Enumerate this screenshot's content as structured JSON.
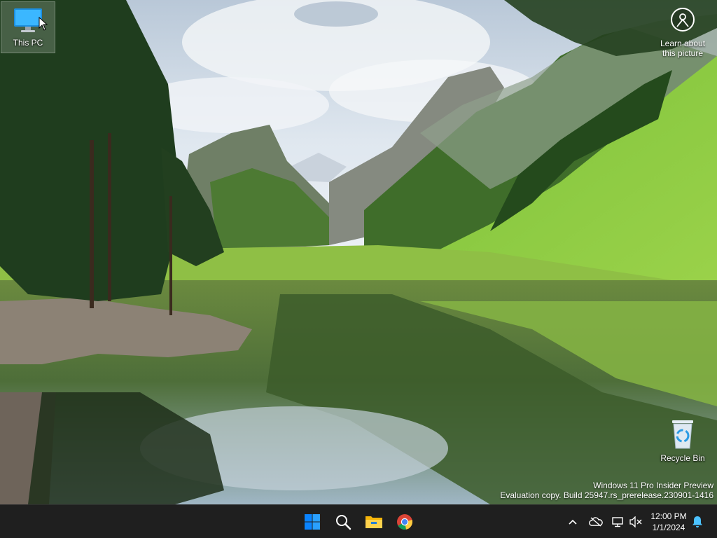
{
  "desktop": {
    "icons": [
      {
        "name": "this-pc",
        "label": "This PC"
      },
      {
        "name": "recycle-bin",
        "label": "Recycle Bin"
      }
    ],
    "spotlight": {
      "label_line1": "Learn about",
      "label_line2": "this picture",
      "icon": "camera-circle-icon"
    }
  },
  "watermark": {
    "line1": "Windows 11 Pro Insider Preview",
    "line2": "Evaluation copy. Build 25947.rs_prerelease.230901-1416"
  },
  "taskbar": {
    "apps": [
      {
        "name": "start",
        "icon": "windows-logo-icon"
      },
      {
        "name": "search",
        "icon": "search-icon"
      },
      {
        "name": "file-explorer",
        "icon": "folder-icon"
      },
      {
        "name": "chrome",
        "icon": "chrome-icon"
      }
    ],
    "tray": {
      "icons": [
        "chevron-up-icon",
        "onedrive-offline-icon",
        "network-icon",
        "volume-muted-icon",
        "notification-bell-icon"
      ],
      "time": "12:00 PM",
      "date": "1/1/2024"
    }
  },
  "colors": {
    "taskbar": "#1f1f1f",
    "windows_blue": "#0a84ff",
    "bell": "#4cc2ff"
  }
}
